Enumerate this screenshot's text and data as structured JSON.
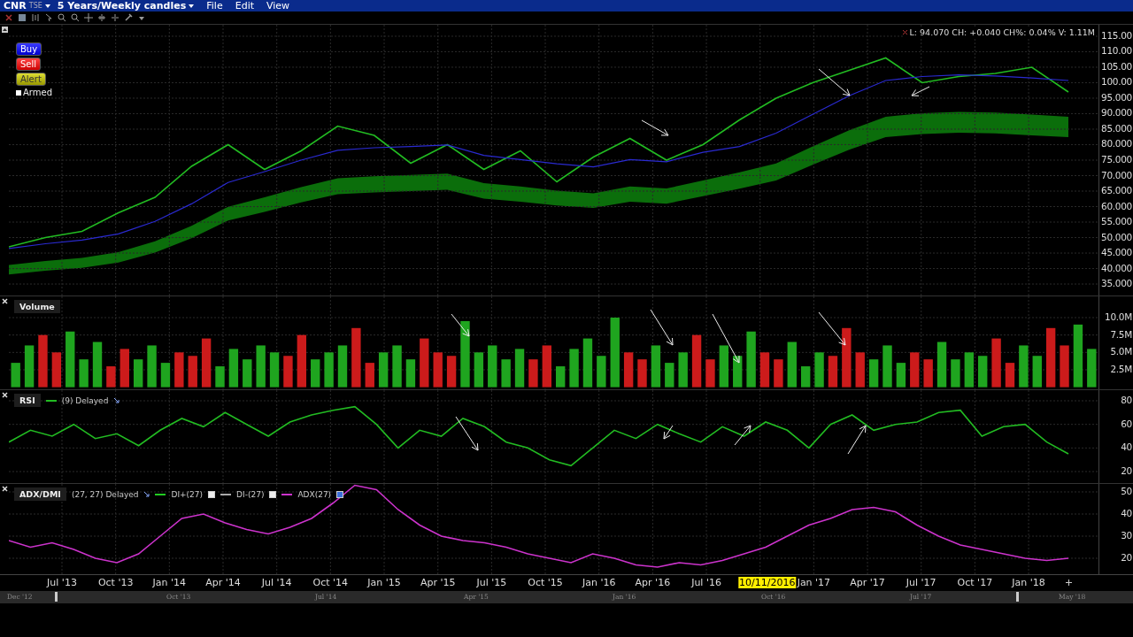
{
  "header": {
    "symbol": "CNR",
    "exchange": "TSE",
    "period": "5 Years/Weekly candles",
    "menus": [
      "File",
      "Edit",
      "View"
    ]
  },
  "order_buttons": [
    {
      "label": "Buy",
      "kind": "buy"
    },
    {
      "label": "Sell",
      "kind": "sell"
    },
    {
      "label": "Alert",
      "kind": "alert"
    }
  ],
  "armed": {
    "label": "Armed",
    "checked": false
  },
  "price_pane": {
    "legend": "L: 94.070 CH: +0.040 CH%: 0.04% V: 1.11M",
    "chart_data": {
      "type": "line",
      "grid": true,
      "ylim": [
        31.3,
        118.7
      ],
      "categories": [
        null,
        null,
        null,
        null,
        null,
        null,
        null,
        null,
        null,
        null,
        null,
        null,
        null,
        null,
        null,
        null,
        null,
        null,
        null,
        null,
        null,
        null,
        null,
        null,
        null,
        null,
        null,
        null,
        null,
        null
      ],
      "series": [
        {
          "color": "#22bb22",
          "values": [
            47,
            50,
            52,
            58,
            63,
            73,
            80,
            72,
            78,
            86,
            83,
            74,
            80,
            72,
            78,
            68,
            76,
            82,
            75,
            80,
            88,
            95,
            100,
            104,
            108,
            100,
            102,
            103,
            105,
            97
          ]
        },
        {
          "color": "#2a2ad0",
          "values": [
            46.5,
            48,
            49.2,
            51.2,
            55.2,
            60.9,
            67.8,
            71.3,
            75,
            78.2,
            79,
            79.4,
            79.9,
            76.5,
            75.2,
            73.8,
            72.8,
            75.2,
            74.5,
            77.5,
            79.4,
            83.7,
            89.8,
            95.8,
            100.7,
            102,
            102.5,
            102.2,
            101.5,
            100.7
          ]
        }
      ],
      "yticks": [
        {
          "value": 115,
          "label": "115.00"
        },
        {
          "value": 110,
          "label": "110.00"
        },
        {
          "value": 105,
          "label": "105.00"
        },
        {
          "value": 100,
          "label": "100.00"
        },
        {
          "value": 95,
          "label": "95.000"
        },
        {
          "value": 90,
          "label": "90.000"
        },
        {
          "value": 85,
          "label": "85.000"
        },
        {
          "value": 80,
          "label": "80.000"
        },
        {
          "value": 75,
          "label": "75.000"
        },
        {
          "value": 70,
          "label": "70.000"
        },
        {
          "value": 65,
          "label": "65.000"
        },
        {
          "value": 60,
          "label": "60.000"
        },
        {
          "value": 55,
          "label": "55.000"
        },
        {
          "value": 50,
          "label": "50.000"
        },
        {
          "value": 45,
          "label": "45.000"
        },
        {
          "value": 40,
          "label": "40.000"
        },
        {
          "value": 35,
          "label": "35.000"
        }
      ]
    }
  },
  "volume_pane": {
    "title": "Volume",
    "chart_data": {
      "type": "bar",
      "grid": true,
      "ylim": [
        -0.3,
        13.05
      ],
      "series": [
        {
          "color": "#1fa51f",
          "values": [
            3.5,
            6,
            null,
            null,
            8,
            4,
            6.5,
            null,
            null,
            4,
            6,
            3.5,
            null,
            null,
            null,
            3,
            5.5,
            4,
            6,
            5,
            null,
            null,
            4,
            5,
            6,
            null,
            null,
            5,
            6,
            4,
            null,
            null,
            null,
            9.5,
            5,
            6,
            4,
            5.5,
            null,
            null,
            3,
            5.5,
            7,
            4.5,
            10,
            null,
            null,
            6,
            3.5,
            5,
            null,
            null,
            6,
            4.5,
            8,
            null,
            null,
            6.5,
            3,
            5,
            null,
            null,
            null,
            4,
            6,
            3.5,
            null,
            null,
            6.5,
            4,
            5,
            4.5,
            null,
            null,
            6,
            4.5,
            null,
            null,
            9,
            5.5
          ]
        },
        {
          "color": "#cc1b1b",
          "values": [
            null,
            null,
            7.5,
            5,
            null,
            null,
            null,
            3,
            5.5,
            null,
            null,
            null,
            5,
            4.5,
            7,
            null,
            null,
            null,
            null,
            null,
            4.5,
            7.5,
            null,
            null,
            null,
            8.5,
            3.5,
            null,
            null,
            null,
            7,
            5,
            4.5,
            null,
            null,
            null,
            null,
            null,
            4,
            6,
            null,
            null,
            null,
            null,
            null,
            5,
            4,
            null,
            null,
            null,
            7.5,
            4,
            null,
            null,
            null,
            5,
            4,
            null,
            null,
            null,
            4.5,
            8.5,
            5,
            null,
            null,
            null,
            5,
            4,
            null,
            null,
            null,
            null,
            7,
            3.5,
            null,
            null,
            8.5,
            6,
            null,
            null
          ]
        }
      ],
      "yticks": [
        {
          "value": 10,
          "label": "10.0M"
        },
        {
          "value": 7.5,
          "label": "7.5M"
        },
        {
          "value": 5,
          "label": "5.0M"
        },
        {
          "value": 2.5,
          "label": "2.5M"
        }
      ]
    }
  },
  "rsi_pane": {
    "title": "RSI",
    "params": "(9) Delayed",
    "chart_data": {
      "type": "line",
      "grid": true,
      "ylim": [
        10.25,
        89
      ],
      "series": [
        {
          "color": "#22bb22",
          "values": [
            45,
            55,
            50,
            60,
            48,
            52,
            42,
            55,
            65,
            58,
            70,
            60,
            50,
            62,
            68,
            72,
            75,
            60,
            40,
            55,
            50,
            65,
            58,
            45,
            40,
            30,
            25,
            40,
            55,
            48,
            60,
            52,
            45,
            58,
            50,
            62,
            55,
            40,
            60,
            68,
            55,
            60,
            62,
            70,
            72,
            50,
            58,
            60,
            45,
            35
          ]
        }
      ],
      "yticks": [
        80,
        60,
        40,
        20
      ]
    }
  },
  "adx_pane": {
    "title": "ADX/DMI",
    "params": "(27, 27) Delayed",
    "toggles": [
      {
        "label": "DI+(27)",
        "color": "#22cc22",
        "checked": false
      },
      {
        "label": "DI-(27)",
        "color": "#aaaaaa",
        "checked": false
      },
      {
        "label": "ADX(27)",
        "color": "#cc33cc",
        "checked": true
      }
    ],
    "chart_data": {
      "type": "line",
      "grid": true,
      "ylim": [
        12.8,
        53.6
      ],
      "series": [
        {
          "color": "#cc33cc",
          "values": [
            28,
            25,
            27,
            24,
            20,
            18,
            22,
            30,
            38,
            40,
            36,
            33,
            31,
            34,
            38,
            45,
            53,
            51,
            42,
            35,
            30,
            28,
            27,
            25,
            22,
            20,
            18,
            22,
            20,
            17,
            16,
            18,
            17,
            19,
            22,
            25,
            30,
            35,
            38,
            42,
            43,
            41,
            35,
            30,
            26,
            24,
            22,
            20,
            19,
            20
          ]
        }
      ],
      "yticks": [
        50,
        40,
        30,
        20
      ]
    }
  },
  "time_axis": [
    {
      "text": "Jul '13",
      "kind": "tick"
    },
    {
      "text": "Oct '13",
      "kind": "tick"
    },
    {
      "text": "Jan '14",
      "kind": "tick"
    },
    {
      "text": "Apr '14",
      "kind": "tick"
    },
    {
      "text": "Jul '14",
      "kind": "tick"
    },
    {
      "text": "Oct '14",
      "kind": "tick"
    },
    {
      "text": "Jan '15",
      "kind": "tick"
    },
    {
      "text": "Apr '15",
      "kind": "tick"
    },
    {
      "text": "Jul '15",
      "kind": "tick"
    },
    {
      "text": "Oct '15",
      "kind": "tick"
    },
    {
      "text": "Jan '16",
      "kind": "tick"
    },
    {
      "text": "Apr '16",
      "kind": "tick"
    },
    {
      "text": "Jul '16",
      "kind": "tick"
    },
    {
      "text": "10/11/2016",
      "kind": "cursor"
    },
    {
      "text": "Jan '17",
      "kind": "tick"
    },
    {
      "text": "Apr '17",
      "kind": "tick"
    },
    {
      "text": "Jul '17",
      "kind": "tick"
    },
    {
      "text": "Oct '17",
      "kind": "tick"
    },
    {
      "text": "Jan '18",
      "kind": "tick"
    }
  ],
  "scrollbar": [
    "Dec '12",
    "Oct '13",
    "Jul '14",
    "Apr '15",
    "Jan '16",
    "Oct '16",
    "Jul '17",
    "May '18"
  ]
}
